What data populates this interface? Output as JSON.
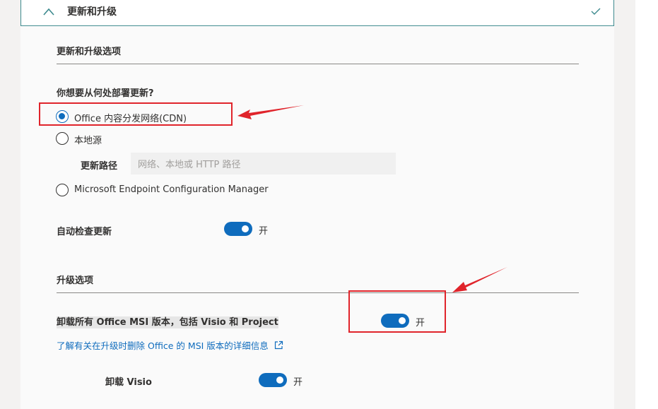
{
  "header": {
    "title": "更新和升级"
  },
  "update_options": {
    "heading": "更新和升级选项",
    "question": "你想要从何处部署更新?",
    "radios": [
      {
        "label": "Office 内容分发网络(CDN)",
        "checked": true
      },
      {
        "label": "本地源",
        "checked": false
      },
      {
        "label": "Microsoft Endpoint Configuration Manager",
        "checked": false
      }
    ],
    "path_label": "更新路径",
    "path_placeholder": "网络、本地或 HTTP 路径",
    "auto_check_label": "自动检查更新",
    "auto_check_state": "开",
    "auto_check_on": true
  },
  "upgrade_options": {
    "heading": "升级选项",
    "uninstall_msi_label": "卸载所有 Office MSI 版本，包括 Visio 和 Project",
    "uninstall_msi_state": "开",
    "uninstall_msi_on": true,
    "learn_more_link": "了解有关在升级时删除 Office 的 MSI 版本的详细信息",
    "uninstall_visio_label": "卸载 Visio",
    "uninstall_visio_state": "开",
    "uninstall_visio_on": true
  },
  "icons": {
    "collapse": "chevron-up-icon",
    "status": "checkmark-icon",
    "external_link": "external-link-icon"
  },
  "colors": {
    "accent": "#0f6cbd",
    "header_border": "#3d8a8e",
    "annotation": "#e0242b"
  }
}
